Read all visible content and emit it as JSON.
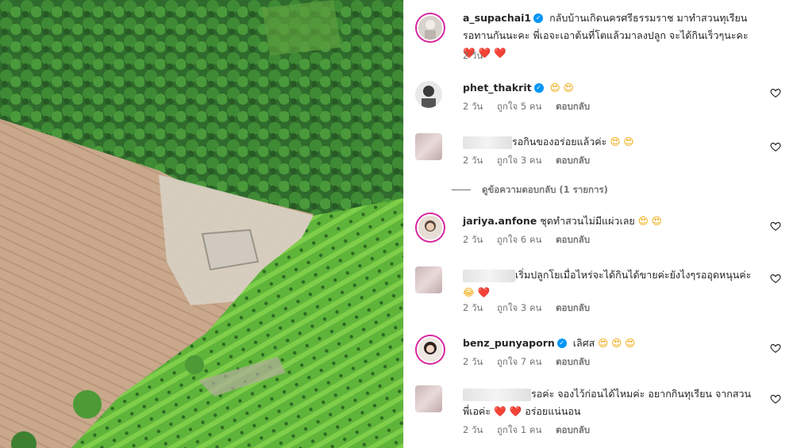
{
  "caption": {
    "username": "a_supachai1",
    "text": "กลับบ้านเกิดนครศรีธรรมราช มาทำสวนทุเรียน รอทานกันนะคะ พี่เอจะเอาต้นที่โตแล้วมาลงปลูก จะได้กินเร็วๆนะคะ",
    "emoji": "❤️ ❤️ ❤️",
    "time": "2 วัน"
  },
  "comments": [
    {
      "username": "phet_thakrit",
      "verified": true,
      "text": "",
      "emoji": "😍 😍",
      "time": "2 วัน",
      "likes": "ถูกใจ 5 คน",
      "reply": "ตอบกลับ"
    },
    {
      "username": "",
      "verified": false,
      "text": "รอกินของอร่อยแล้วค่ะ",
      "emoji": "😍 😍",
      "time": "2 วัน",
      "likes": "ถูกใจ 3 คน",
      "reply": "ตอบกลับ"
    },
    {
      "username": "jariya.anfone",
      "verified": false,
      "text": "ชุดทำสวนไม่มีแผ่วเลย",
      "emoji": "😍 😍",
      "time": "2 วัน",
      "likes": "ถูกใจ 6 คน",
      "reply": "ตอบกลับ"
    },
    {
      "username": "",
      "verified": false,
      "text": "เริ่มปลูกโยเมื่อไหร่จะได้กินได้ขายค่ะยังไงๆรออุดหนุนค่ะ",
      "emoji": "😂 ❤️",
      "time": "2 วัน",
      "likes": "ถูกใจ 3 คน",
      "reply": "ตอบกลับ"
    },
    {
      "username": "benz_punyaporn",
      "verified": true,
      "text": "เลิศส",
      "emoji": "😍 😍 😍",
      "time": "2 วัน",
      "likes": "ถูกใจ 7 คน",
      "reply": "ตอบกลับ"
    },
    {
      "username": "",
      "verified": false,
      "text": "รอค่ะ จองไว้ก่อนได้ไหมค่ะ อยากกินทุเรียน จากสวนพี่เอค่ะ",
      "emoji": "❤️ ❤️",
      "text2": "อร่อยแน่นอน",
      "time": "2 วัน",
      "likes": "ถูกใจ 1 คน",
      "reply": "ตอบกลับ"
    }
  ],
  "view_replies": "ดูข้อความตอบกลับ (1 รายการ)",
  "colors": {
    "verified": "#0095f6",
    "meta": "#737373",
    "ring": "#d6249f"
  },
  "icons": {
    "heart": "heart-outline-icon",
    "verified": "verified-badge-icon"
  }
}
